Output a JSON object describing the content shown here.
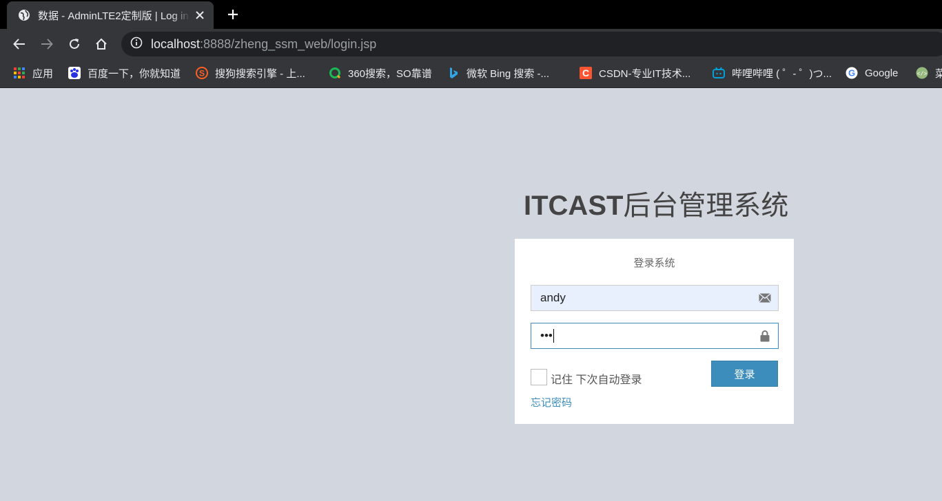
{
  "tab": {
    "title": "数据 - AdminLTE2定制版 | Log in",
    "favicon": "globe-icon"
  },
  "toolbar": {
    "url_host": "localhost",
    "url_rest": ":8888/zheng_ssm_web/login.jsp"
  },
  "bookmarks": [
    {
      "label": "应用",
      "icon": "apps-grid-icon"
    },
    {
      "label": "百度一下，你就知道",
      "icon": "baidu-icon"
    },
    {
      "label": "搜狗搜索引擎 - 上...",
      "icon": "sogou-icon"
    },
    {
      "label": "360搜索，SO靠谱",
      "icon": "so360-icon"
    },
    {
      "label": "微软 Bing 搜索 -...",
      "icon": "bing-icon"
    },
    {
      "label": "CSDN-专业IT技术...",
      "icon": "csdn-icon"
    },
    {
      "label": "哔哩哔哩 ( ゜- ゜)つ...",
      "icon": "bilibili-icon"
    },
    {
      "label": "Google",
      "icon": "google-icon"
    },
    {
      "label": "菜",
      "icon": "runoob-icon"
    }
  ],
  "login": {
    "brand_bold": "ITCAST",
    "brand_light": "后台管理系统",
    "box_msg": "登录系统",
    "username_value": "andy",
    "password_mask": "•••",
    "remember_label": "记住 下次自动登录",
    "submit_label": "登录",
    "forgot_label": "忘记密码"
  },
  "colors": {
    "page_bg": "#d2d6de",
    "primary": "#3c8dbc",
    "browser_chrome": "#35363a"
  }
}
